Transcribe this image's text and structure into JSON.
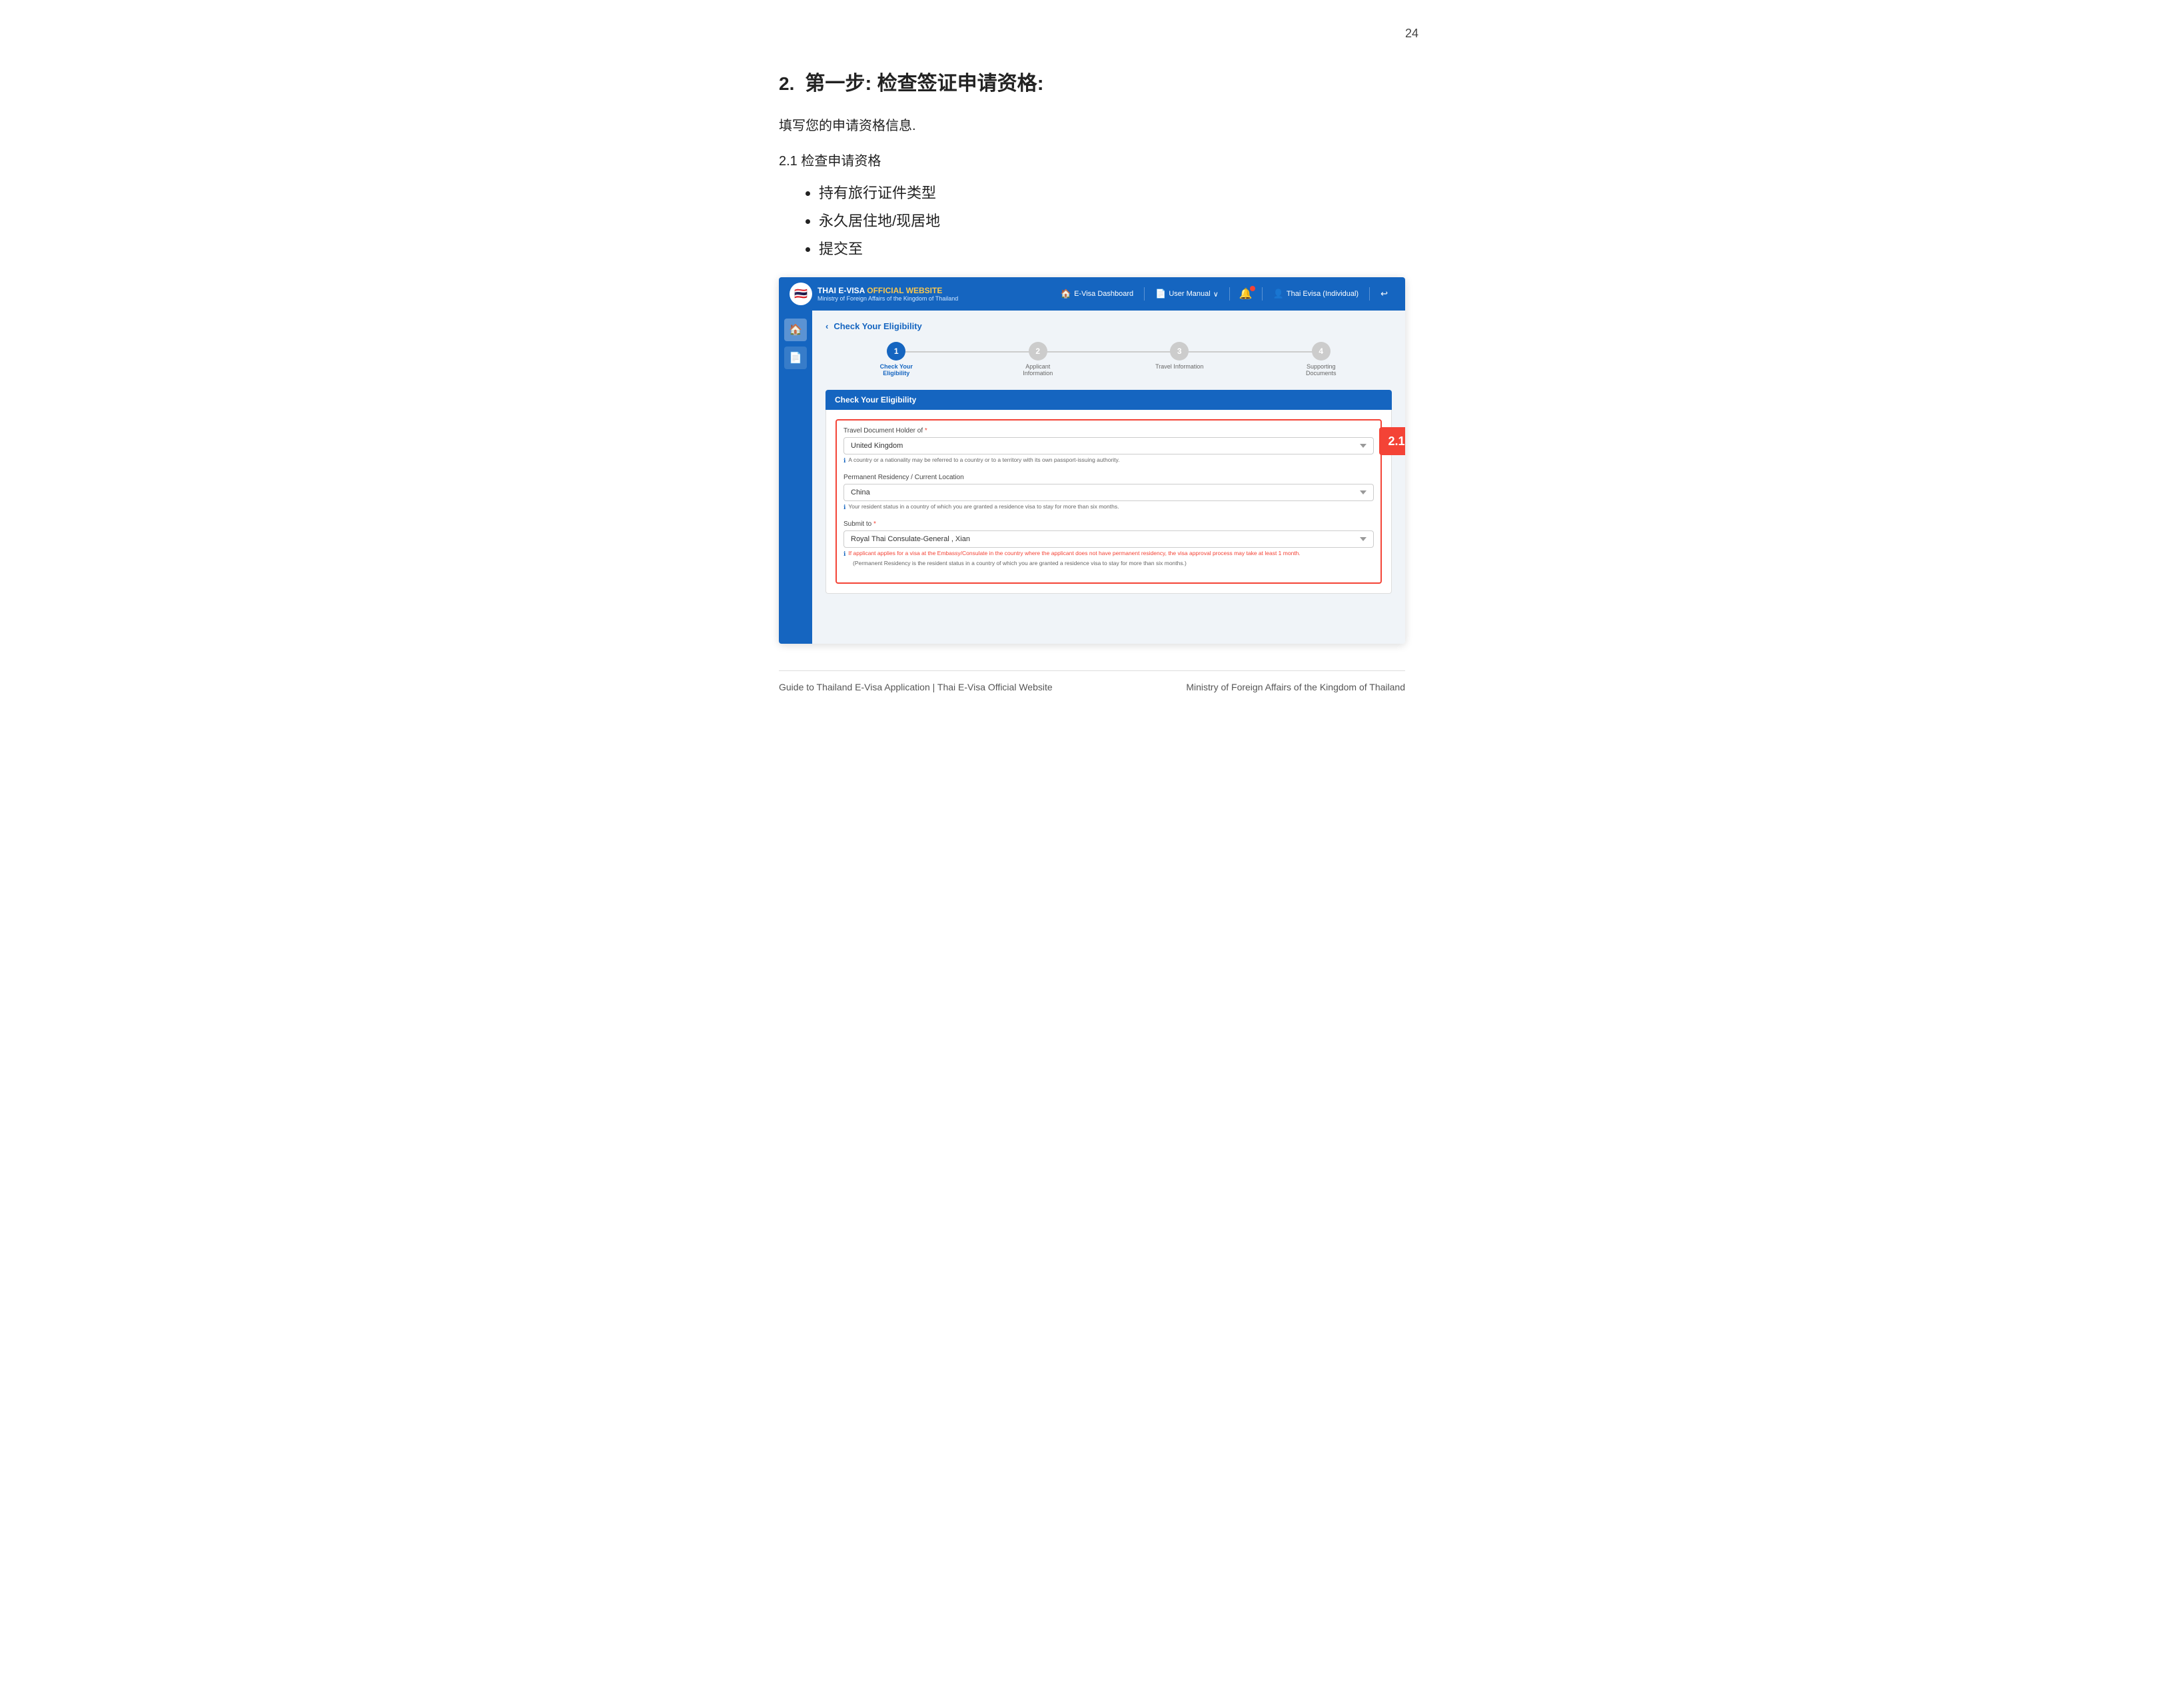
{
  "page": {
    "number": "24"
  },
  "heading": {
    "number": "2.",
    "title": "第一步: 检查签证申请资格:"
  },
  "intro": "填写您的申请资格信息.",
  "subheading": "2.1 检查申请资格",
  "bullets": [
    "持有旅行证件类型",
    "永久居住地/现居地",
    "提交至"
  ],
  "navbar": {
    "brand_title": "THAI E-VISA ",
    "brand_title_highlight": "OFFICIAL WEBSITE",
    "brand_subtitle": "Ministry of Foreign Affairs of the Kingdom of Thailand",
    "nav_items": [
      {
        "icon": "🏠",
        "label": "E-Visa Dashboard"
      },
      {
        "icon": "📄",
        "label": "User Manual"
      },
      {
        "icon": "🔔",
        "label": ""
      },
      {
        "icon": "👤",
        "label": "Thai Evisa (Individual)"
      },
      {
        "icon": "↩",
        "label": ""
      }
    ]
  },
  "steps": [
    {
      "number": "1",
      "label": "Check Your Eligibility",
      "active": true
    },
    {
      "number": "2",
      "label": "Applicant Information",
      "active": false
    },
    {
      "number": "3",
      "label": "Travel Information",
      "active": false
    },
    {
      "number": "4",
      "label": "Supporting Documents",
      "active": false
    }
  ],
  "card_header": "Check Your Eligibility",
  "page_title": "Check Your Eligibility",
  "form": {
    "field1": {
      "label": "Travel Document Holder of",
      "required": true,
      "value": "United Kingdom",
      "hint": "A country or a nationality may be referred to a country or to a territory with its own passport-issuing authority."
    },
    "field2": {
      "label": "Permanent Residency / Current Location",
      "value": "China",
      "hint": "Your resident status in a country of which you are granted a residence visa to stay for more than six months."
    },
    "field3": {
      "label": "Submit to",
      "required": true,
      "value": "Royal Thai Consulate-General , Xian",
      "hint1": "If applicant applies for a visa at the Embassy/Consulate in the country where the applicant does not have permanent residency, the visa approval process may take at least 1 month.",
      "hint2": "(Permanent Residency is the resident status in a country of which you are granted a residence visa to stay for more than six months.)"
    }
  },
  "badge": "2.1",
  "footer": {
    "left": "Guide to Thailand E-Visa Application | Thai E-Visa Official Website",
    "right": "Ministry of Foreign Affairs of the Kingdom of Thailand"
  }
}
